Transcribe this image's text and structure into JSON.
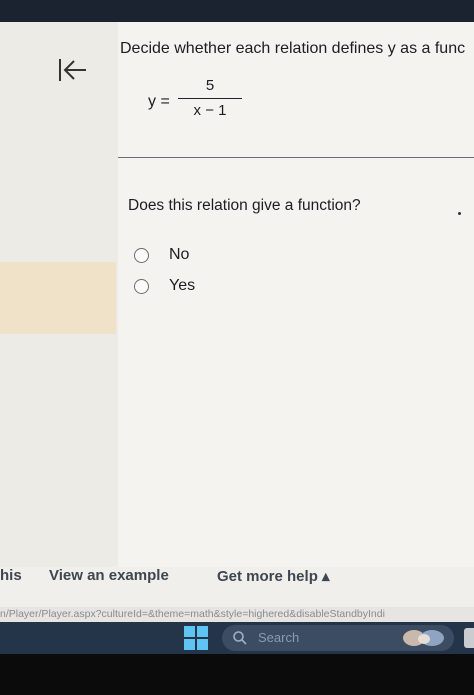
{
  "question": {
    "title": "Decide whether each relation defines y as a func",
    "equation": {
      "lhs": "y =",
      "numerator": "5",
      "denominator": "x − 1"
    },
    "prompt": "Does this relation give a function?",
    "options": [
      {
        "label": "No",
        "selected": false
      },
      {
        "label": "Yes",
        "selected": false
      }
    ]
  },
  "footer": {
    "left_partial": "his",
    "view_example": "View an example",
    "get_help": "Get more help ▴"
  },
  "status_url": "n/Player/Player.aspx?cultureId=&theme=math&style=highered&disableStandbyIndi",
  "taskbar": {
    "search_placeholder": "Search"
  },
  "colors": {
    "content_bg": "#f4f3ef",
    "highlight": "#efe2c8",
    "taskbar": "#24354a",
    "link": "#3e4650"
  }
}
